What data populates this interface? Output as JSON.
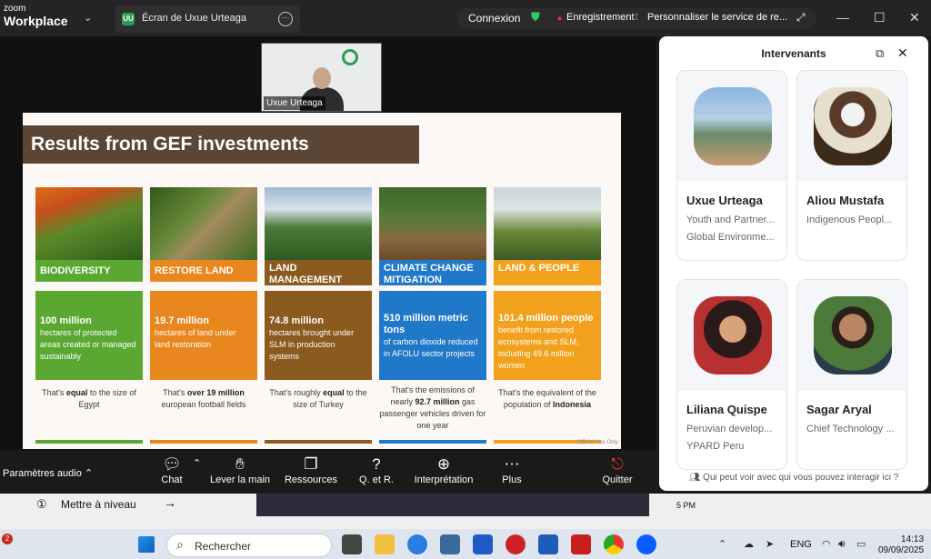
{
  "app": {
    "logo_top": "zoom",
    "logo_bottom": "Workplace",
    "tab_label": "Écran de Uxue Urteaga",
    "tab_icon": "UU"
  },
  "topbar": {
    "connexion": "Connexion",
    "recording": "Enregistrement",
    "customize": "Personnaliser le service de re..."
  },
  "self_video": {
    "name": "Uxue Urteaga"
  },
  "slide": {
    "title": "Results from GEF investments",
    "official": "Official Use Only",
    "columns": [
      {
        "header": "BIODIVERSITY",
        "stat": "100 million",
        "desc": "hectares of protected areas created or managed sustainably",
        "note_pre": "That's ",
        "note_bold": "equal",
        "note_post": " to the size of Egypt",
        "color": "#5aa832"
      },
      {
        "header": "RESTORE LAND",
        "stat": "19.7 million",
        "desc": "hectares of land under land restoration",
        "note_pre": "That's ",
        "note_bold": "over 19 million",
        "note_post": " european football fields",
        "color": "#e8871e"
      },
      {
        "header": "LAND MANAGEMENT",
        "stat": "74.8 million",
        "desc": "hectares brought under SLM in production systems",
        "note_pre": "That's roughly ",
        "note_bold": "equal",
        "note_post": " to the size of Turkey",
        "color": "#8b5a1e"
      },
      {
        "header": "CLIMATE CHANGE MITIGATION",
        "stat": "510 million metric tons",
        "desc": "of carbon dioxide reduced in AFOLU sector projects",
        "note_pre": "That's the emissions of nearly ",
        "note_bold": "92.7 million",
        "note_post": " gas passenger vehicles driven for one year",
        "color": "#1f78c8"
      },
      {
        "header": "LAND & PEOPLE",
        "stat": "101.4 million people",
        "desc": "benefit from restored ecosystems and SLM, including 49.6 million women",
        "note_pre": "That's the equivalent of the population of ",
        "note_bold": "Indonesia",
        "note_post": "",
        "color": "#f2a11c"
      }
    ]
  },
  "toolbar": {
    "audio": "Paramètres audio",
    "chat": "Chat",
    "raise": "Lever la main",
    "resources": "Ressources",
    "qa": "Q. et R.",
    "interp": "Interprétation",
    "more": "Plus",
    "quit": "Quitter"
  },
  "tray": {
    "text": "Mettre à niveau",
    "number": "①",
    "time_partial": "5 PM"
  },
  "panel": {
    "title": "Intervenants",
    "footer": "Qui peut voir avec qui vous pouvez interagir ici ?",
    "speakers": [
      {
        "name": "Uxue Urteaga",
        "line1": "Youth and Partner...",
        "line2": "Global Environme..."
      },
      {
        "name": "Aliou Mustafa",
        "line1": "Indigenous Peopl...",
        "line2": ""
      },
      {
        "name": "Liliana Quispe",
        "line1": "Peruvian develop...",
        "line2": "YPARD Peru"
      },
      {
        "name": "Sagar Aryal",
        "line1": "Chief Technology ...",
        "line2": ""
      }
    ]
  },
  "taskbar": {
    "search": "Rechercher",
    "lang": "ENG",
    "time": "14:13",
    "date": "09/09/2025",
    "badge": "2"
  }
}
